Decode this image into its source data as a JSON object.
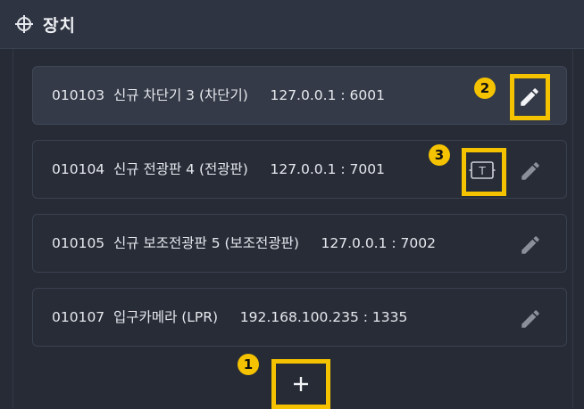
{
  "header": {
    "title": "장치",
    "icon": "device-network-icon"
  },
  "devices": [
    {
      "text": "010103  신규 차단기 3 (차단기)     127.0.0.1 : 6001"
    },
    {
      "text": "010104  신규 전광판 4 (전광판)     127.0.0.1 : 7001"
    },
    {
      "text": "010105  신규 보조전광판 5 (보조전광판)     127.0.0.1 : 7002"
    },
    {
      "text": "010107  입구카메라 (LPR)     192.168.100.235 : 1335"
    }
  ],
  "annotations": {
    "add": "1",
    "edit": "2",
    "text": "3"
  },
  "colors": {
    "highlight": "#f5c200",
    "background": "#262b36",
    "header": "#2e3441"
  }
}
